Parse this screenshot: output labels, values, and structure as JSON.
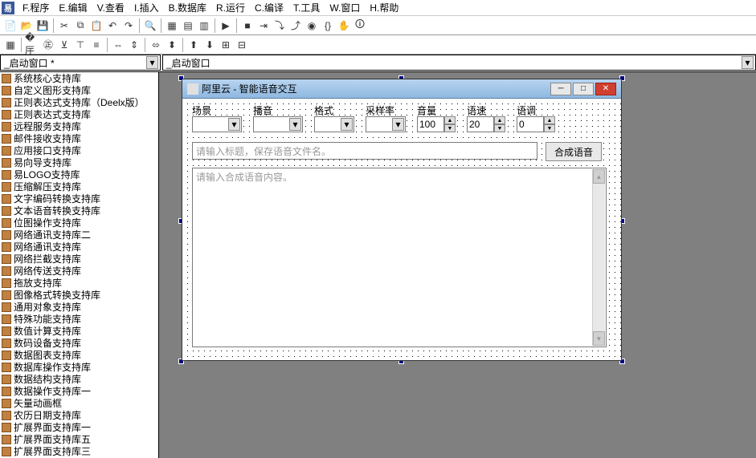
{
  "menu": [
    "F.程序",
    "E.编辑",
    "V.查看",
    "I.插入",
    "B.数据库",
    "R.运行",
    "C.编译",
    "T.工具",
    "W.窗口",
    "H.帮助"
  ],
  "tabs": {
    "left": "_启动窗口 *",
    "right": "_启动窗口"
  },
  "tree": [
    "系统核心支持库",
    "自定义图形支持库",
    "正则表达式支持库（Deelx版）",
    "正则表达式支持库",
    "远程服务支持库",
    "邮件接收支持库",
    "应用接口支持库",
    "易向导支持库",
    "易LOGO支持库",
    "压缩解压支持库",
    "文字编码转换支持库",
    "文本语音转换支持库",
    "位图操作支持库",
    "网络通讯支持库二",
    "网络通讯支持库",
    "网络拦截支持库",
    "网络传送支持库",
    "拖放支持库",
    "图像格式转换支持库",
    "通用对象支持库",
    "特殊功能支持库",
    "数值计算支持库",
    "数码设备支持库",
    "数据图表支持库",
    "数据库操作支持库",
    "数据结构支持库",
    "数据操作支持库一",
    "矢量动画框",
    "农历日期支持库",
    "扩展界面支持库一",
    "扩展界面支持库五",
    "扩展界面支持库三"
  ],
  "win": {
    "title": "阿里云 - 智能语音交互",
    "labels": {
      "scene": "场景",
      "voice": "播音",
      "format": "格式",
      "rate": "采样率",
      "volume": "音量",
      "speed": "语速",
      "pitch": "语调"
    },
    "values": {
      "volume": "100",
      "speed": "20",
      "pitch": "0"
    },
    "placeholders": {
      "title": "请输入标题，保存语音文件名。",
      "content": "请输入合成语音内容。"
    },
    "buttons": {
      "synth": "合成语音"
    }
  }
}
